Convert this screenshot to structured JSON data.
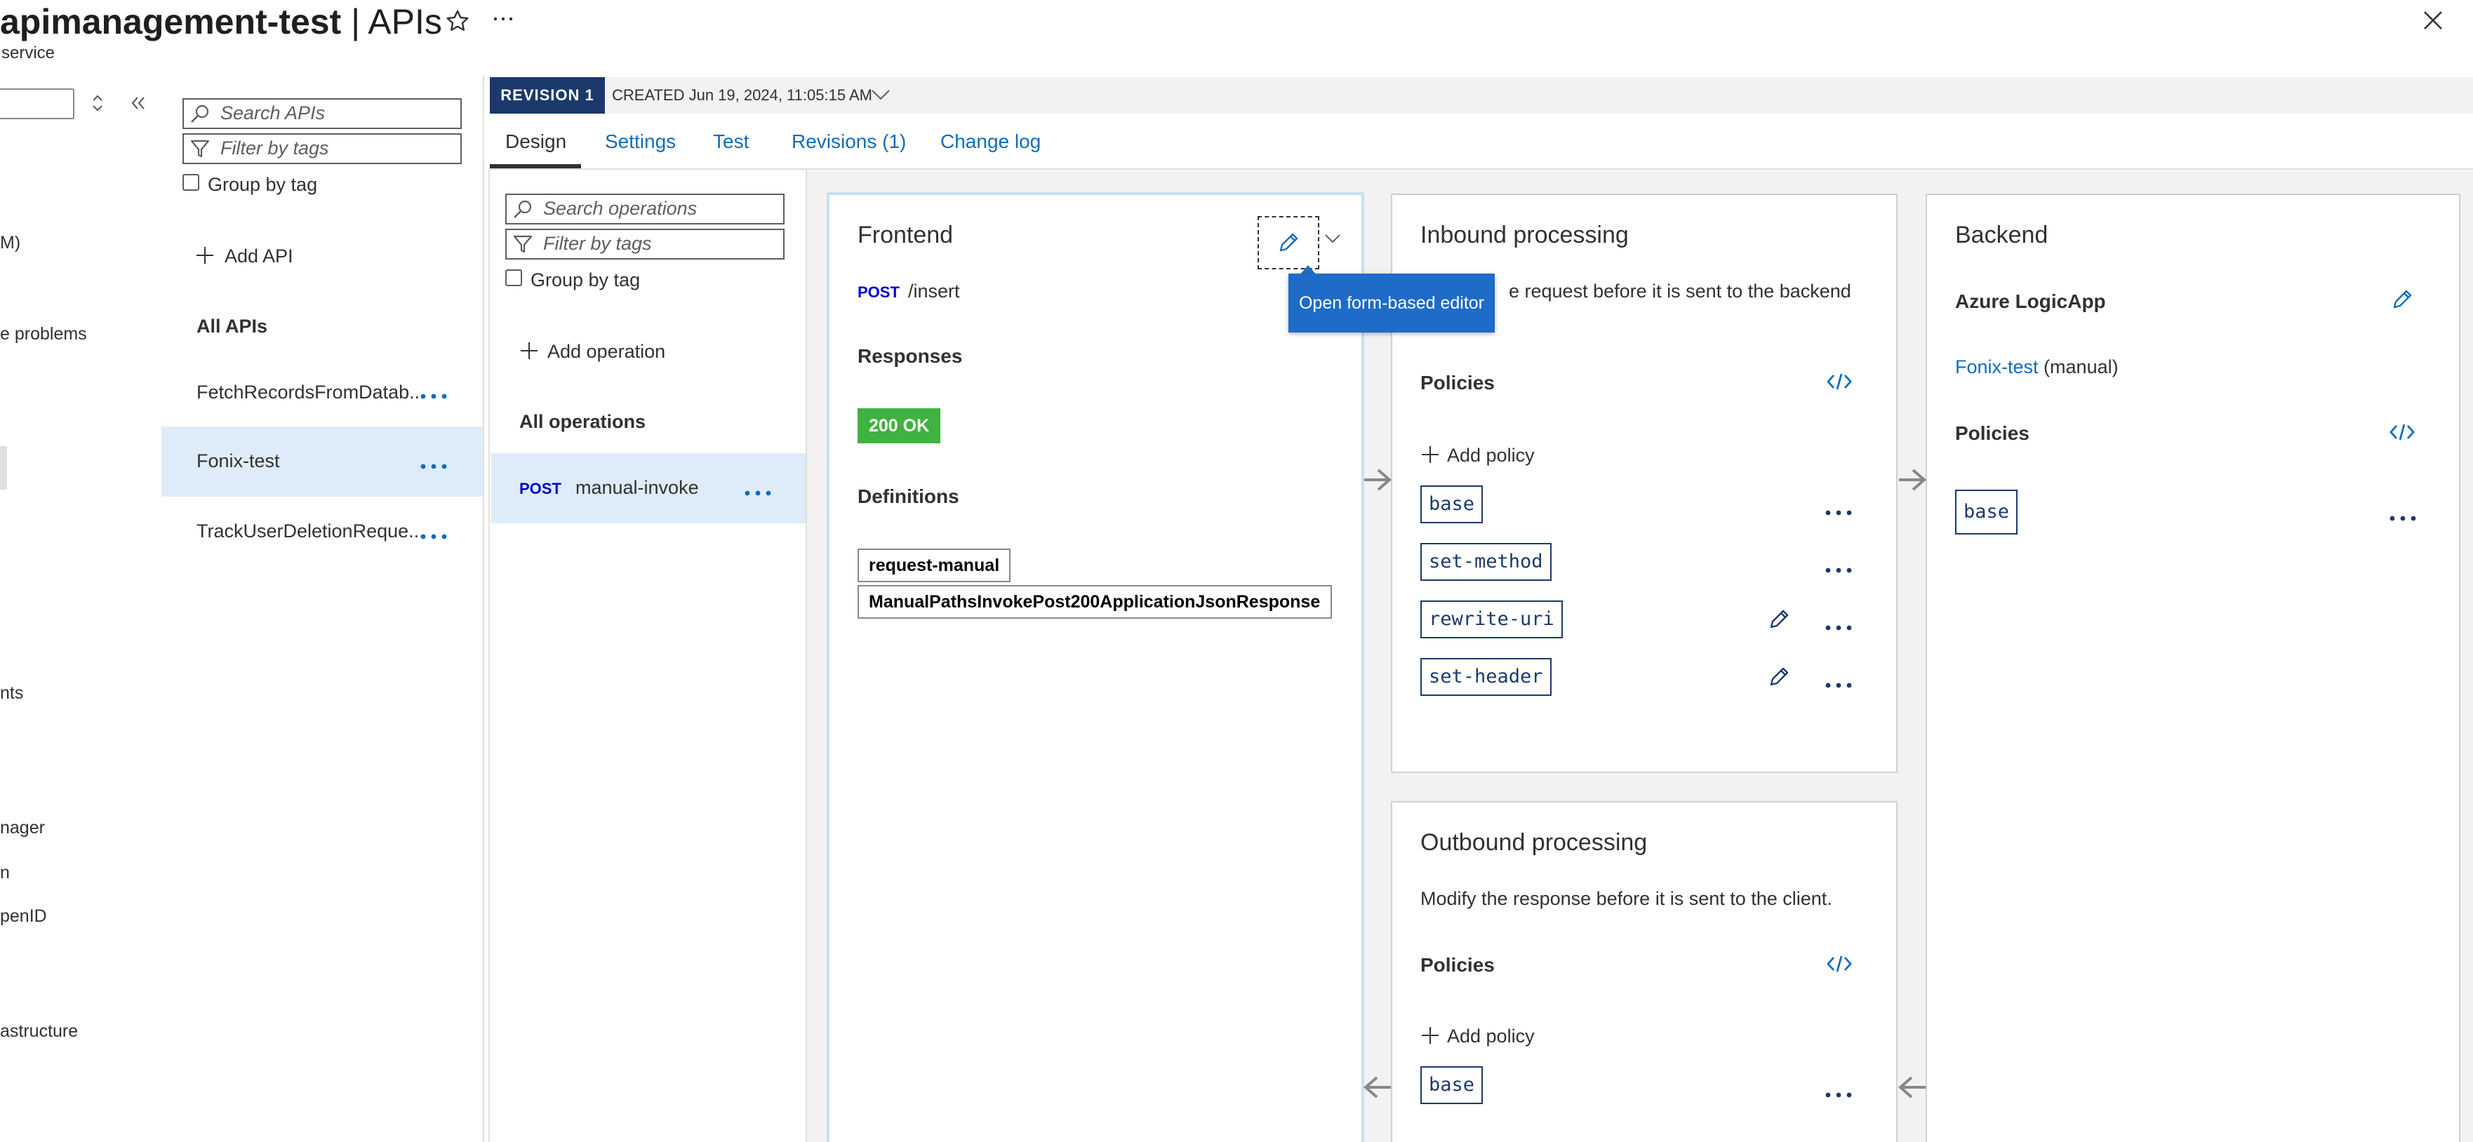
{
  "header": {
    "title_bold": "apimanagement-test",
    "title_rest": " | APIs",
    "subtitle": "service"
  },
  "nav": {
    "items": [
      "M)",
      "e problems",
      "nts",
      "nager",
      "n",
      "penID",
      "astructure"
    ]
  },
  "apis": {
    "search_placeholder": "Search APIs",
    "filter_placeholder": "Filter by tags",
    "group_by_tag": "Group by tag",
    "add_api": "Add API",
    "section": "All APIs",
    "items": [
      "FetchRecordsFromDatab...",
      "Fonix-test",
      "TrackUserDeletionReque..."
    ]
  },
  "revision": {
    "badge": "REVISION 1",
    "created": "CREATED Jun 19, 2024, 11:05:15 AM"
  },
  "tabs": [
    "Design",
    "Settings",
    "Test",
    "Revisions (1)",
    "Change log"
  ],
  "operations": {
    "search_placeholder": "Search operations",
    "filter_placeholder": "Filter by tags",
    "group_by_tag": "Group by tag",
    "add_operation": "Add operation",
    "section": "All operations",
    "items": [
      {
        "method": "POST",
        "name": "manual-invoke"
      }
    ]
  },
  "frontend": {
    "title": "Frontend",
    "method": "POST",
    "path": "/insert",
    "responses_head": "Responses",
    "response_status": "200 OK",
    "definitions_head": "Definitions",
    "definitions": [
      "request-manual",
      "ManualPathsInvokePost200ApplicationJsonResponse"
    ],
    "tooltip": "Open form-based editor"
  },
  "inbound": {
    "title": "Inbound processing",
    "description": "e request before it is sent to the backend",
    "policies_head": "Policies",
    "add_policy": "Add policy",
    "policies": [
      "base",
      "set-method",
      "rewrite-uri",
      "set-header"
    ]
  },
  "outbound": {
    "title": "Outbound processing",
    "description": "Modify the response before it is sent to the client.",
    "policies_head": "Policies",
    "add_policy": "Add policy",
    "policies": [
      "base"
    ]
  },
  "backend": {
    "title": "Backend",
    "service_type": "Azure LogicApp",
    "service_link": "Fonix-test",
    "service_suffix": " (manual)",
    "policies_head": "Policies",
    "policies": [
      "base"
    ]
  },
  "colors": {
    "accent": "#0f6cbd",
    "badge": "#1b3a6b",
    "selected_row": "#deecf9",
    "status_ok": "#3fb23f",
    "tooltip": "#1e6cc8"
  }
}
